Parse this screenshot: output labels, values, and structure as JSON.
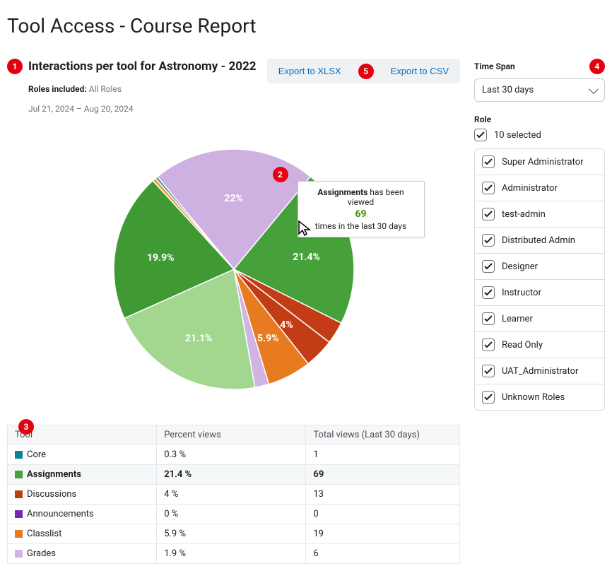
{
  "page_title": "Tool Access - Course Report",
  "report": {
    "title": "Interactions per tool for Astronomy - 2022",
    "roles_label": "Roles included:",
    "roles_value": "All Roles",
    "date_range": "Jul 21, 2024 – Aug 20, 2024"
  },
  "export": {
    "xlsx": "Export to XLSX",
    "csv": "Export to CSV"
  },
  "tooltip": {
    "name": "Assignments",
    "mid": " has been viewed",
    "count": "69",
    "tail": "times in the last 30 days"
  },
  "filters": {
    "time_span_label": "Time Span",
    "time_span_value": "Last 30 days",
    "role_label": "Role",
    "role_summary": "10 selected",
    "roles": [
      "Super Administrator",
      "Administrator",
      "test-admin",
      "Distributed Admin",
      "Designer",
      "Instructor",
      "Learner",
      "Read Only",
      "UAT_Administrator",
      "Unknown Roles"
    ]
  },
  "table": {
    "col_tool": "Tool",
    "col_percent": "Percent views",
    "col_total": "Total views (Last 30 days)",
    "rows": [
      {
        "color": "#09818f",
        "name": "Core",
        "percent": "0.3 %",
        "total": "1",
        "hl": false
      },
      {
        "color": "#46a13a",
        "name": "Assignments",
        "percent": "21.4 %",
        "total": "69",
        "hl": true
      },
      {
        "color": "#c23d16",
        "name": "Discussions",
        "percent": "4 %",
        "total": "13",
        "hl": false
      },
      {
        "color": "#7328b5",
        "name": "Announcements",
        "percent": "0 %",
        "total": "0",
        "hl": false
      },
      {
        "color": "#e87a1f",
        "name": "Classlist",
        "percent": "5.9 %",
        "total": "19",
        "hl": false
      },
      {
        "color": "#d1b3e6",
        "name": "Grades",
        "percent": "1.9 %",
        "total": "6",
        "hl": false
      }
    ]
  },
  "annotations": {
    "a1": "1",
    "a2": "2",
    "a3": "3",
    "a4": "4",
    "a5": "5"
  },
  "chart_data": {
    "type": "pie",
    "title": "Interactions per tool for Astronomy - 2022",
    "unit": "percent views",
    "series": [
      {
        "name": "Unlabeled (purple)",
        "value": 22.0,
        "color": "#cfb1e1",
        "label": "22%"
      },
      {
        "name": "Assignments",
        "value": 21.4,
        "color": "#46a13a",
        "label": "21.4%"
      },
      {
        "name": "Discussions (slice 1)",
        "value": 3.0,
        "color": "#c23d16",
        "label": ""
      },
      {
        "name": "Discussions (slice 2)",
        "value": 4.0,
        "color": "#c23d16",
        "label": "4%"
      },
      {
        "name": "Classlist",
        "value": 5.9,
        "color": "#e87a1f",
        "label": "5.9%"
      },
      {
        "name": "Grades",
        "value": 1.9,
        "color": "#d1b3e6",
        "label": ""
      },
      {
        "name": "Unlabeled (light green)",
        "value": 21.1,
        "color": "#a3d68f",
        "label": "21.1%"
      },
      {
        "name": "Unlabeled (green)",
        "value": 19.9,
        "color": "#3f9a33",
        "label": "19.9%"
      },
      {
        "name": "Unlabeled (orange sliver)",
        "value": 0.5,
        "color": "#f0a24c",
        "label": ""
      },
      {
        "name": "Core",
        "value": 0.3,
        "color": "#09818f",
        "label": ""
      }
    ]
  }
}
